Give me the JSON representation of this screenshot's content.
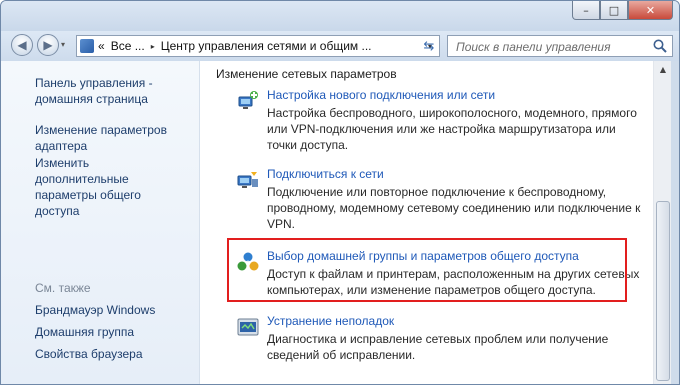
{
  "window_controls": {
    "minimize": "–",
    "maximize": "□",
    "close": "✕"
  },
  "nav": {
    "back": "◀",
    "forward": "▶",
    "recent": "▾",
    "breadcrumb": [
      "«",
      "Все ...",
      "▸",
      "Центр управления сетями и общим ..."
    ],
    "address_dropdown": "▾",
    "refresh": "⇆"
  },
  "search": {
    "placeholder": "Поиск в панели управления"
  },
  "sidebar": {
    "links": [
      "Панель управления - домашняя страница",
      "Изменение параметров адаптера",
      "Изменить дополнительные параметры общего доступа"
    ],
    "see_also_heading": "См. также",
    "see_also": [
      "Брандмауэр Windows",
      "Домашняя группа",
      "Свойства браузера"
    ]
  },
  "content": {
    "section_title": "Изменение сетевых параметров",
    "tasks": [
      {
        "title": "Настройка нового подключения или сети",
        "description": "Настройка беспроводного, широкополосного, модемного, прямого или VPN-подключения или же настройка маршрутизатора или точки доступа."
      },
      {
        "title": "Подключиться к сети",
        "description": "Подключение или повторное подключение к беспроводному, проводному, модемному сетевому соединению или подключение к VPN."
      },
      {
        "title": "Выбор домашней группы и параметров общего доступа",
        "description": "Доступ к файлам и принтерам, расположенным на других сетевых компьютерах, или изменение параметров общего доступа."
      },
      {
        "title": "Устранение неполадок",
        "description": "Диагностика и исправление сетевых проблем или получение сведений об исправлении."
      }
    ]
  },
  "scrollbar": {
    "up_arrow": "▲"
  },
  "colors": {
    "link": "#1f59b8",
    "highlight": "#e21e1e",
    "sidebar_link": "#1e3e6c"
  }
}
